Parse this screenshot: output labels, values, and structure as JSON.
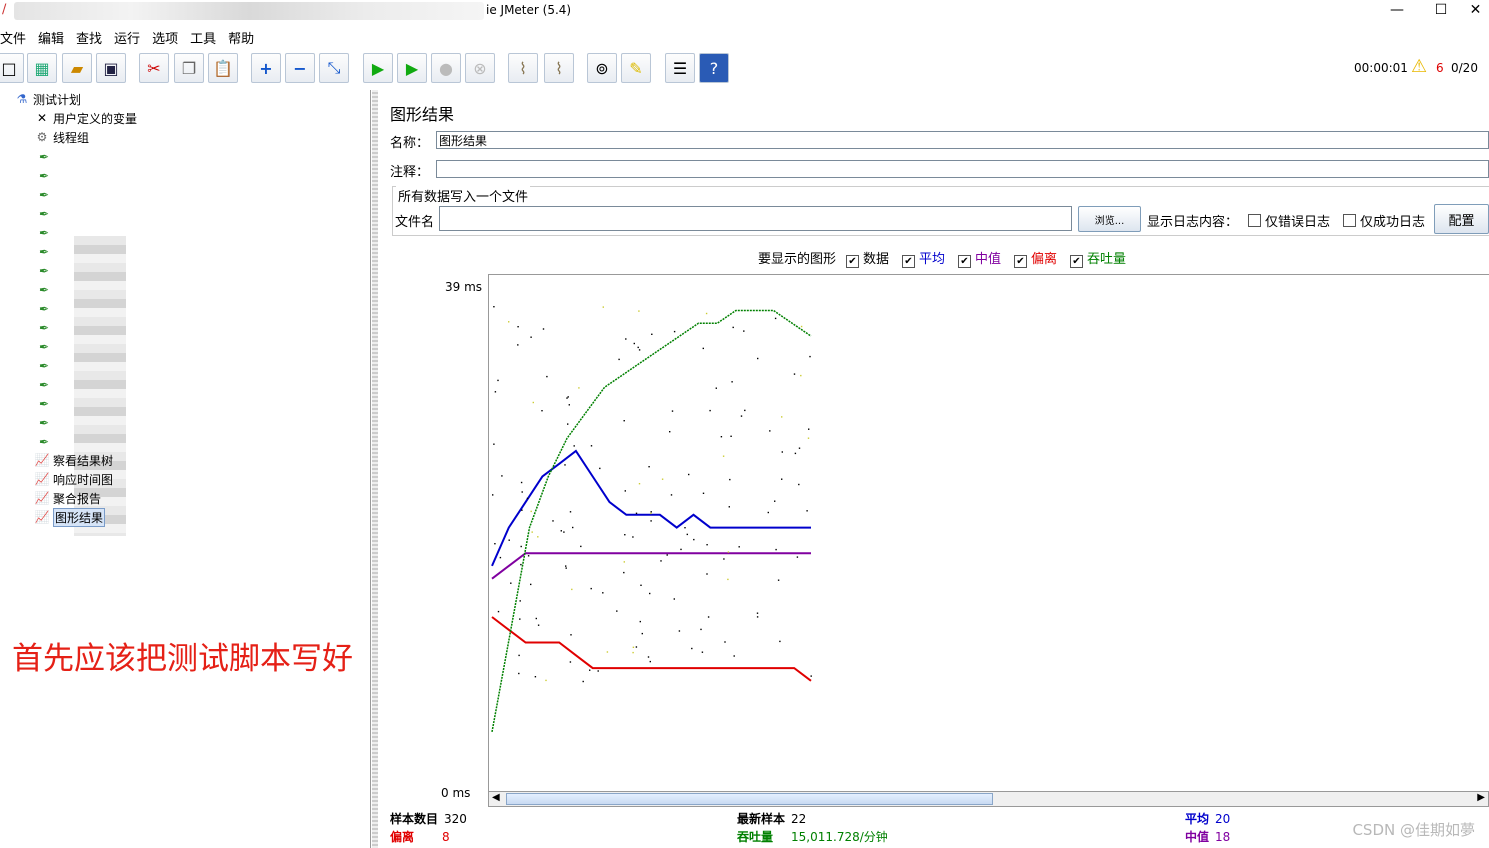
{
  "window": {
    "title": "ie JMeter (5.4)",
    "minimize": "—",
    "maximize": "☐",
    "close": "✕"
  },
  "menu": [
    "文件",
    "编辑",
    "查找",
    "运行",
    "选项",
    "工具",
    "帮助"
  ],
  "status": {
    "elapsed": "00:00:01",
    "warnings": "6",
    "threads": "0/20"
  },
  "tree": {
    "root": "测试计划",
    "vars": "用户定义的变量",
    "group": "线程组",
    "listeners": [
      "察看结果树",
      "响应时间图",
      "聚合报告",
      "图形结果"
    ]
  },
  "annotation": "首先应该把测试脚本写好",
  "panel": {
    "title": "图形结果",
    "name_label": "名称：",
    "name_value": "图形结果",
    "comment_label": "注释：",
    "comment_value": "",
    "file_group": "所有数据写入一个文件",
    "file_label": "文件名",
    "file_value": "",
    "browse": "浏览...",
    "log_label": "显示日志内容：",
    "errors_only": "仅错误日志",
    "success_only": "仅成功日志",
    "configure": "配置"
  },
  "graph_options": {
    "label": "要显示的图形",
    "items": [
      {
        "text": "数据",
        "color": "#000000",
        "checked": "✔"
      },
      {
        "text": "平均",
        "color": "#0000cc",
        "checked": "✔"
      },
      {
        "text": "中值",
        "color": "#8000a0",
        "checked": "✔"
      },
      {
        "text": "偏离",
        "color": "#e00000",
        "checked": "✔"
      },
      {
        "text": "吞吐量",
        "color": "#008000",
        "checked": "✔"
      }
    ]
  },
  "chart_data": {
    "type": "scatter",
    "ylabel_top": "39 ms",
    "ylabel_bottom": "0 ms",
    "ylim": [
      0,
      39
    ],
    "series": [
      {
        "name": "平均",
        "color": "#0000cc",
        "values_ms": [
          17,
          20,
          22,
          24,
          25,
          26,
          24,
          22,
          21,
          21,
          21,
          20,
          21,
          20,
          20,
          20,
          20,
          20,
          20,
          20
        ]
      },
      {
        "name": "中值",
        "color": "#8000a0",
        "values_ms": [
          16,
          17,
          18,
          18,
          18,
          18,
          18,
          18,
          18,
          18,
          18,
          18,
          18,
          18,
          18,
          18,
          18,
          18,
          18,
          18
        ]
      },
      {
        "name": "偏离",
        "color": "#e00000",
        "values_ms": [
          13,
          12,
          11,
          11,
          11,
          10,
          9,
          9,
          9,
          9,
          9,
          9,
          9,
          9,
          9,
          9,
          9,
          9,
          9,
          8
        ]
      },
      {
        "name": "吞吐量",
        "color": "#008000",
        "values_ms": [
          4,
          12,
          20,
          24,
          27,
          29,
          31,
          32,
          33,
          34,
          35,
          36,
          36,
          37,
          37,
          37,
          36,
          35
        ]
      }
    ]
  },
  "stats": {
    "samples_label": "样本数目",
    "samples": "320",
    "latest_label": "最新样本",
    "latest": "22",
    "avg_label": "平均",
    "avg": "20",
    "dev_label": "偏离",
    "dev": "8",
    "tp_label": "吞吐量",
    "tp": "15,011.728/分钟",
    "median_label": "中值",
    "median": "18"
  },
  "watermark": "CSDN @佳期如夢"
}
